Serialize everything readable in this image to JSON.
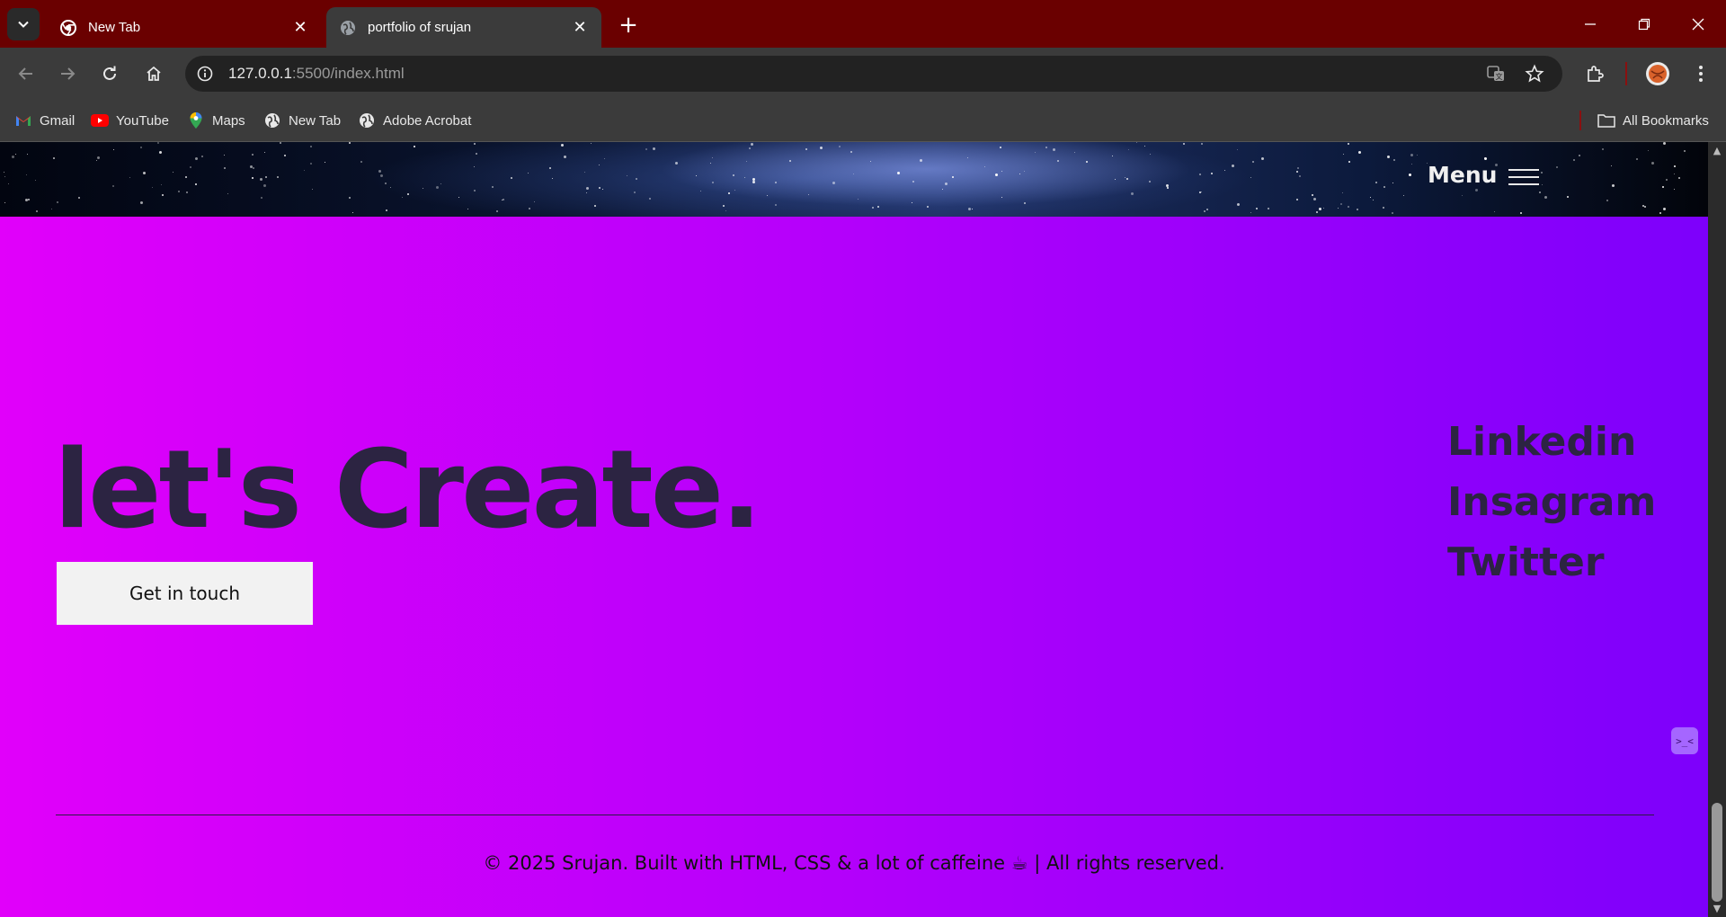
{
  "browser": {
    "tabs": [
      {
        "title": "New Tab",
        "favicon": "chrome-icon",
        "active": false
      },
      {
        "title": "portfolio of srujan",
        "favicon": "globe-icon",
        "active": true
      }
    ],
    "url_host": "127.0.0.1",
    "url_rest": ":5500/index.html",
    "bookmarks": [
      {
        "label": "Gmail",
        "icon": "gmail-icon"
      },
      {
        "label": "YouTube",
        "icon": "youtube-icon"
      },
      {
        "label": "Maps",
        "icon": "maps-icon"
      },
      {
        "label": "New Tab",
        "icon": "globe-icon"
      },
      {
        "label": "Adobe Acrobat",
        "icon": "globe-icon"
      }
    ],
    "all_bookmarks_label": "All Bookmarks",
    "colors": {
      "tabstrip": "#6a0000",
      "toolbar": "#3b3b3b"
    }
  },
  "page": {
    "menu_label": "Menu",
    "hero_title": "let's Create.",
    "cta_label": "Get in touch",
    "social_links": [
      "Linkedin",
      "Insagram",
      "Twitter"
    ],
    "footer_text": "© 2025 Srujan. Built with HTML, CSS & a lot of caffeine ☕ | All rights reserved.",
    "widget_glyph": ">_<",
    "colors": {
      "gradient_start": "#e100fa",
      "gradient_end": "#7d00fb",
      "heading": "#2c2442",
      "button_bg": "#f2f2f2"
    }
  }
}
